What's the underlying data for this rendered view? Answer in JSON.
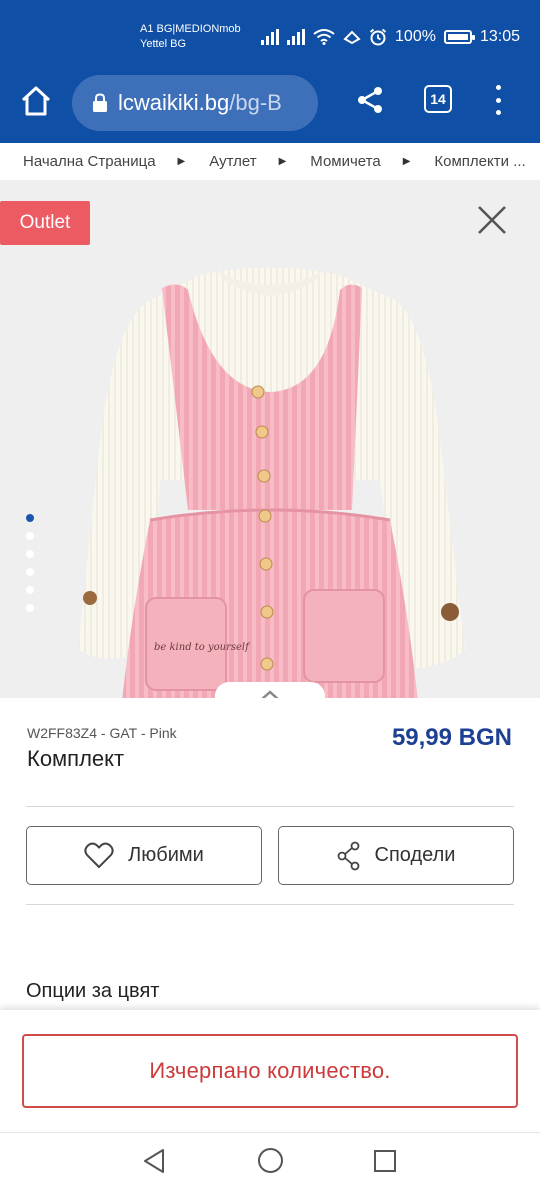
{
  "status_bar": {
    "carrier_line1": "A1 BG|MEDIONmob",
    "carrier_line2": "Yettel BG",
    "battery": "100%",
    "time": "13:05"
  },
  "browser": {
    "domain": "lcwaikiki.bg",
    "path": "/bg-B",
    "tab_count": "14"
  },
  "breadcrumb": [
    "Начална Страница",
    "Аутлет",
    "Момичета",
    "Комплекти ..."
  ],
  "gallery": {
    "badge": "Outlet",
    "embroidery_text": "be kind to yourself",
    "image_count": 6,
    "active_index": 0
  },
  "product": {
    "sku": "W2FF83Z4 - GAT - Pink",
    "name": "Комплект",
    "price": "59,99 BGN"
  },
  "actions": {
    "favorites_label": "Любими",
    "share_label": "Сподели"
  },
  "color_options": {
    "title": "Опции за цвят"
  },
  "sticky": {
    "soldout_label": "Изчерпано количество."
  },
  "colors": {
    "brand_blue": "#0f4fa5",
    "price_blue": "#1d3f94",
    "outlet_red": "#ec5a62",
    "soldout_red": "#cc3b3b"
  }
}
